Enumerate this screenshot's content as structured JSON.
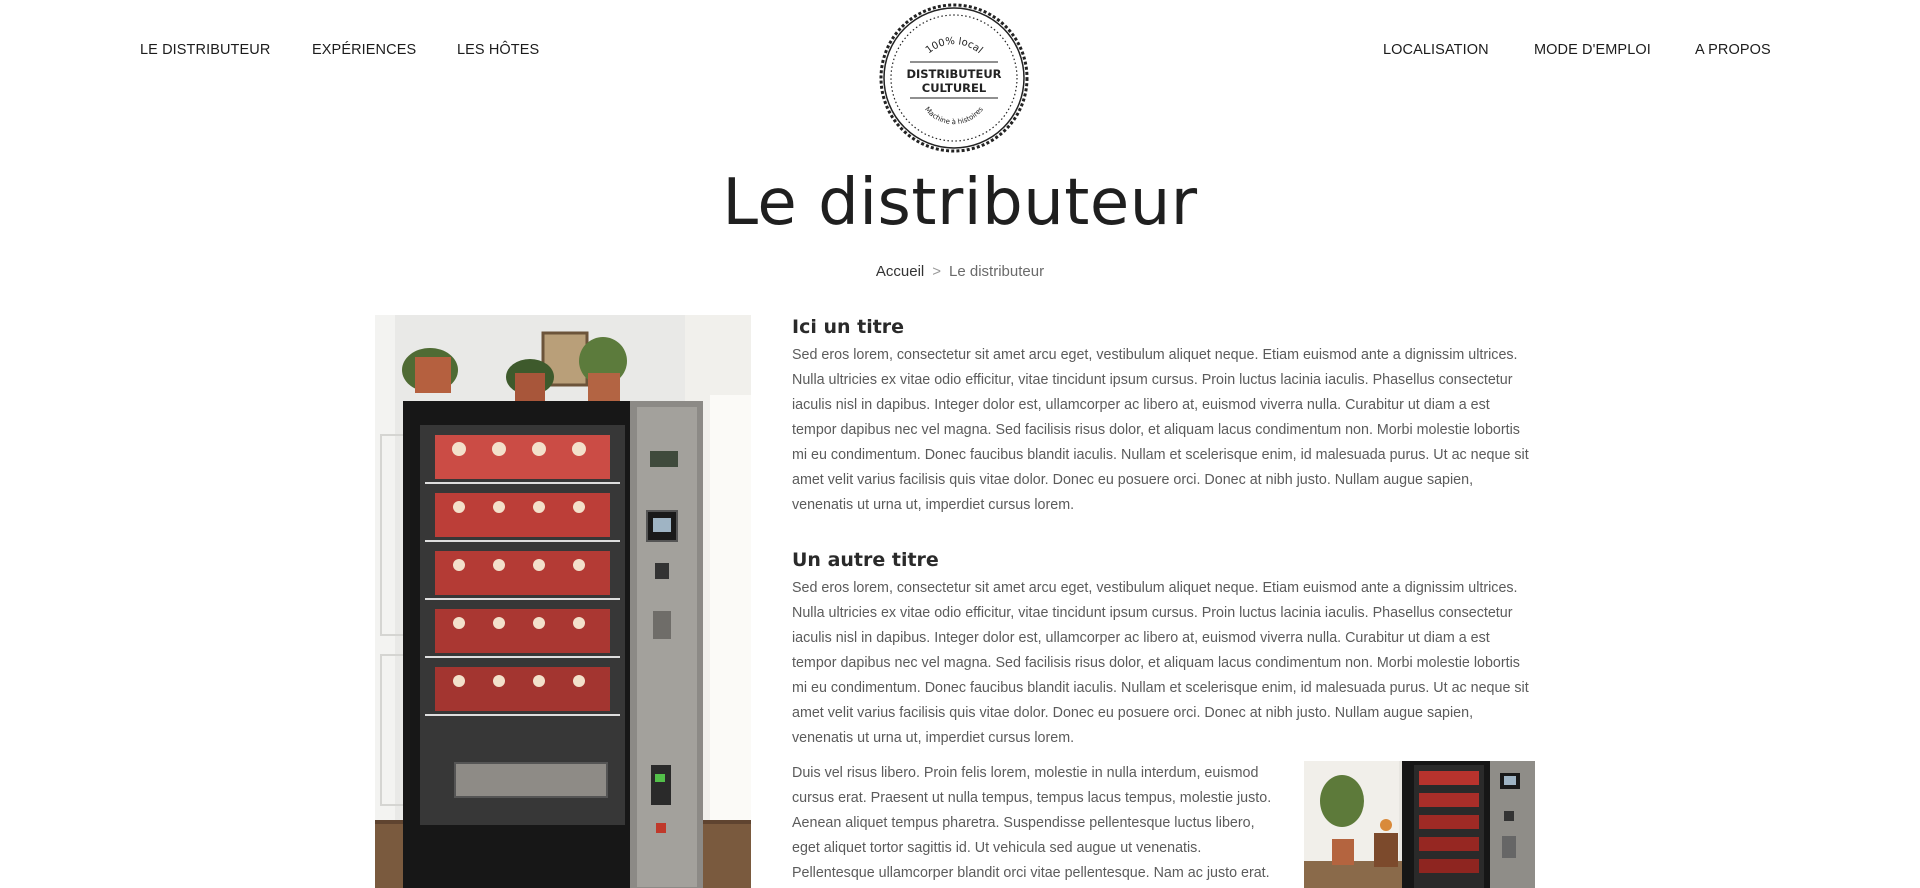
{
  "nav": {
    "left": [
      "LE DISTRIBUTEUR",
      "EXPÉRIENCES",
      "LES HÔTES"
    ],
    "right": [
      "LOCALISATION",
      "MODE D'EMPLOI",
      "A PROPOS"
    ]
  },
  "logo": {
    "top_text": "100% local",
    "line1": "DISTRIBUTEUR",
    "line2": "CULTUREL",
    "bottom_text": "Machine à histoires"
  },
  "page_title": "Le distributeur",
  "breadcrumb": {
    "home": "Accueil",
    "separator": ">",
    "current": "Le distributeur"
  },
  "sections": [
    {
      "title": "Ici un titre",
      "text": "Sed eros lorem, consectetur sit amet arcu eget, vestibulum aliquet neque. Etiam euismod ante a dignissim ultrices. Nulla ultricies ex vitae odio efficitur, vitae tincidunt ipsum cursus. Proin luctus lacinia iaculis. Phasellus consectetur iaculis nisl in dapibus. Integer dolor est, ullamcorper ac libero at, euismod viverra nulla. Curabitur ut diam a est tempor dapibus nec vel magna. Sed facilisis risus dolor, et aliquam lacus condimentum non. Morbi molestie lobortis mi eu condimentum. Donec faucibus blandit iaculis. Nullam et scelerisque enim, id malesuada purus. Ut ac neque sit amet velit varius facilisis quis vitae dolor. Donec eu posuere orci. Donec at nibh justo. Nullam augue sapien, venenatis ut urna ut, imperdiet cursus lorem."
    },
    {
      "title": "Un autre titre",
      "text": "Sed eros lorem, consectetur sit amet arcu eget, vestibulum aliquet neque. Etiam euismod ante a dignissim ultrices. Nulla ultricies ex vitae odio efficitur, vitae tincidunt ipsum cursus. Proin luctus lacinia iaculis. Phasellus consectetur iaculis nisl in dapibus. Integer dolor est, ullamcorper ac libero at, euismod viverra nulla. Curabitur ut diam a est tempor dapibus nec vel magna. Sed facilisis risus dolor, et aliquam lacus condimentum non. Morbi molestie lobortis mi eu condimentum. Donec faucibus blandit iaculis. Nullam et scelerisque enim, id malesuada purus. Ut ac neque sit amet velit varius facilisis quis vitae dolor. Donec eu posuere orci. Donec at nibh justo. Nullam augue sapien, venenatis ut urna ut, imperdiet cursus lorem."
    }
  ],
  "extra_paragraph": "Duis vel risus libero. Proin felis lorem, molestie in nulla interdum, euismod cursus erat. Praesent ut nulla tempus, tempus lacus tempus, molestie justo. Aenean aliquet tempus pharetra. Suspendisse pellentesque luctus libero, eget aliquet tortor sagittis id. Ut vehicula sed augue ut venenatis. Pellentesque ullamcorper blandit orci vitae pellentesque. Nam ac justo erat. Donec eget",
  "colors": {
    "background": "#ffffff",
    "nav_text": "#1c1c1c",
    "body_text": "#5b5b5b",
    "title_text": "#1f1f1f"
  }
}
